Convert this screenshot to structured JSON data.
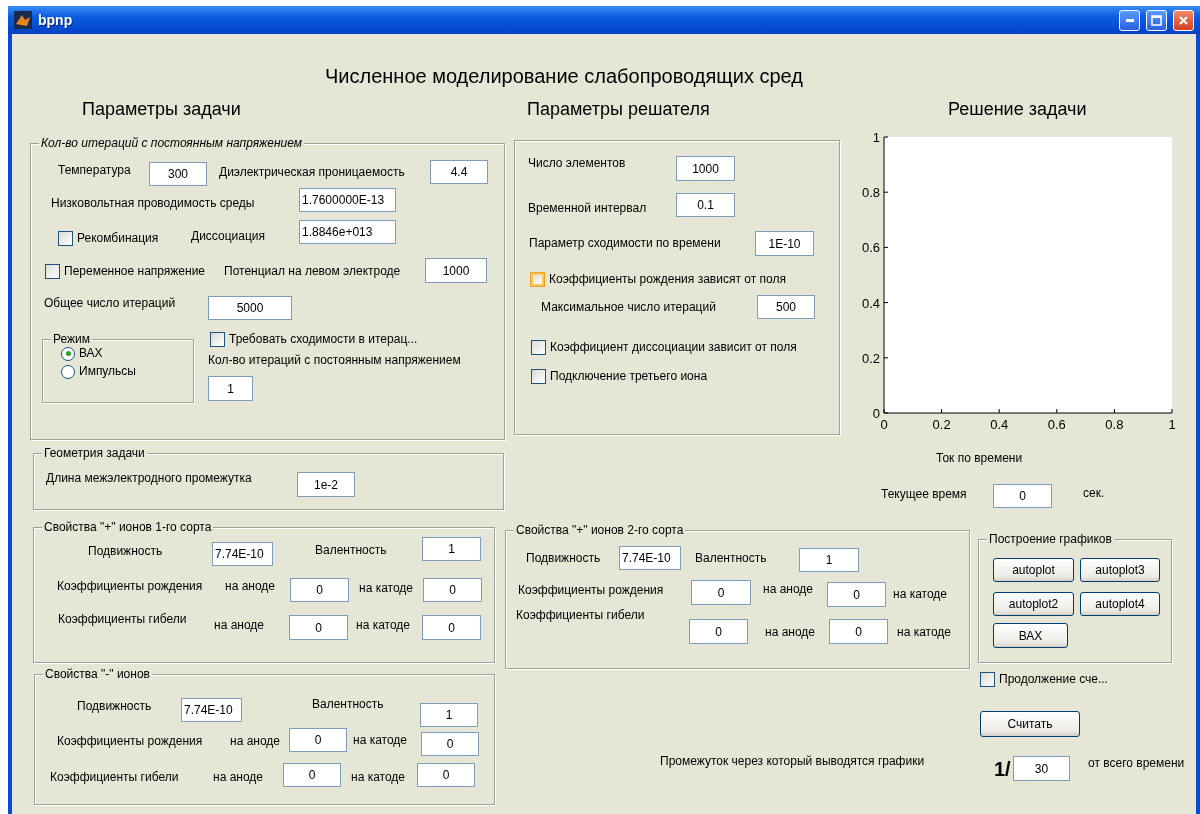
{
  "window": {
    "title": "bpnp"
  },
  "heading": "Численное моделирование слабопроводящих сред",
  "section_titles": [
    "Параметры задачи",
    "Параметры решателя",
    "Решение задачи"
  ],
  "panels": [
    {
      "title": "Кол-во итераций с постоянным напряжением",
      "controls": [
        {
          "kind": "label",
          "text": "Температура"
        },
        {
          "kind": "field",
          "value": "300"
        },
        {
          "kind": "label",
          "text": "Диэлектрическая проницаемость"
        },
        {
          "kind": "field",
          "value": "4.4"
        },
        {
          "kind": "label",
          "text": "Низковольтная проводимость среды"
        },
        {
          "kind": "field",
          "value": "1.7600000E-13"
        },
        {
          "kind": "checkbox",
          "text": "Рекомбинация",
          "checked": false
        },
        {
          "kind": "label",
          "text": "Диссоциация"
        },
        {
          "kind": "field",
          "value": "1.8846e+013"
        },
        {
          "kind": "checkbox",
          "text": "Переменное напряжение",
          "checked": false
        },
        {
          "kind": "label",
          "text": "Потенциал на левом электроде"
        },
        {
          "kind": "field",
          "value": "1000"
        },
        {
          "kind": "label",
          "text": "Общее число итераций"
        },
        {
          "kind": "field",
          "value": "5000"
        },
        {
          "kind": "checkbox",
          "text": "Требовать сходимости в итерац...",
          "checked": false
        },
        {
          "kind": "label",
          "text": "Кол-во итераций с постоянным напряжением"
        },
        {
          "kind": "field",
          "value": "1"
        }
      ]
    },
    {
      "title": "Режим",
      "controls": [
        {
          "kind": "radio",
          "text": "ВАХ",
          "selected": true
        },
        {
          "kind": "radio",
          "text": "Импульсы",
          "selected": false
        }
      ]
    },
    {
      "controls": [
        {
          "kind": "label",
          "text": "Число элементов"
        },
        {
          "kind": "field",
          "value": "1000"
        },
        {
          "kind": "label",
          "text": "Временной интервал"
        },
        {
          "kind": "field",
          "value": "0.1"
        },
        {
          "kind": "label",
          "text": "Параметр сходимости по времени"
        },
        {
          "kind": "field",
          "value": "1E-10"
        },
        {
          "kind": "checkbox",
          "text": "Коэффициенты рождения зависят от поля",
          "checked": false,
          "hovered": true
        },
        {
          "kind": "label",
          "text": "Максимальное число итераций"
        },
        {
          "kind": "field",
          "value": "500"
        },
        {
          "kind": "checkbox",
          "text": "Коэффициент диссоциации зависит от поля",
          "checked": false
        },
        {
          "kind": "checkbox",
          "text": "Подключение третьего иона",
          "checked": false
        }
      ]
    },
    {
      "title": "Геометрия задачи",
      "controls": [
        {
          "kind": "label",
          "text": "Длина межэлектродного промежутка"
        },
        {
          "kind": "field",
          "value": "1e-2"
        }
      ]
    },
    {
      "title": "Свойства \"+\" ионов 1-го сорта",
      "controls": [
        {
          "kind": "label",
          "text": "Подвижность"
        },
        {
          "kind": "field",
          "value": "7.74E-10"
        },
        {
          "kind": "label",
          "text": "Валентность"
        },
        {
          "kind": "field",
          "value": "1"
        },
        {
          "kind": "label",
          "text": "Коэффициенты рождения"
        },
        {
          "kind": "label",
          "text": "на аноде"
        },
        {
          "kind": "field",
          "value": "0"
        },
        {
          "kind": "label",
          "text": "на катоде"
        },
        {
          "kind": "field",
          "value": "0"
        },
        {
          "kind": "label",
          "text": "Коэффициенты гибели"
        },
        {
          "kind": "label",
          "text": "на аноде"
        },
        {
          "kind": "field",
          "value": "0"
        },
        {
          "kind": "label",
          "text": "на катоде"
        },
        {
          "kind": "field",
          "value": "0"
        }
      ]
    },
    {
      "title": "Свойства \"-\" ионов",
      "controls": [
        {
          "kind": "label",
          "text": "Подвижность"
        },
        {
          "kind": "field",
          "value": "7.74E-10"
        },
        {
          "kind": "label",
          "text": "Валентность"
        },
        {
          "kind": "field",
          "value": "1"
        },
        {
          "kind": "label",
          "text": "Коэффициенты рождения"
        },
        {
          "kind": "label",
          "text": "на аноде"
        },
        {
          "kind": "field",
          "value": "0"
        },
        {
          "kind": "label",
          "text": "на катоде"
        },
        {
          "kind": "field",
          "value": "0"
        },
        {
          "kind": "label",
          "text": "Коэффициенты гибели"
        },
        {
          "kind": "label",
          "text": "на аноде"
        },
        {
          "kind": "field",
          "value": "0"
        },
        {
          "kind": "label",
          "text": "на катоде"
        },
        {
          "kind": "field",
          "value": "0"
        }
      ]
    },
    {
      "title": "Свойства \"+\" ионов 2-го сорта",
      "controls": [
        {
          "kind": "label",
          "text": "Подвижность"
        },
        {
          "kind": "field",
          "value": "7.74E-10"
        },
        {
          "kind": "label",
          "text": "Валентность"
        },
        {
          "kind": "field",
          "value": "1"
        },
        {
          "kind": "label",
          "text": "Коэффициенты рождения"
        },
        {
          "kind": "field",
          "value": "0"
        },
        {
          "kind": "label",
          "text": "на аноде"
        },
        {
          "kind": "field",
          "value": "0"
        },
        {
          "kind": "label",
          "text": "на катоде"
        },
        {
          "kind": "label",
          "text": "Коэффициенты гибели"
        },
        {
          "kind": "field",
          "value": "0"
        },
        {
          "kind": "label",
          "text": "на аноде"
        },
        {
          "kind": "field",
          "value": "0"
        },
        {
          "kind": "label",
          "text": "на катоде"
        }
      ]
    },
    {
      "title": "Построение графиков",
      "controls": [
        {
          "kind": "button",
          "text": "autoplot"
        },
        {
          "kind": "button",
          "text": "autoplot3"
        },
        {
          "kind": "button",
          "text": "autoplot2"
        },
        {
          "kind": "button",
          "text": "autoplot4"
        },
        {
          "kind": "button",
          "text": "ВАХ"
        }
      ]
    }
  ],
  "plot": {
    "chart_data": {
      "type": "line",
      "xlim": [
        0,
        1
      ],
      "ylim": [
        0,
        1
      ],
      "xticks": [
        0,
        0.2,
        0.4,
        0.6,
        0.8,
        1
      ],
      "yticks": [
        0,
        0.2,
        0.4,
        0.6,
        0.8,
        1
      ]
    },
    "caption": "Ток по времени"
  },
  "controls": [
    {
      "kind": "label",
      "text": "Текущее время"
    },
    {
      "kind": "field",
      "value": "0"
    },
    {
      "kind": "label",
      "text": "сек."
    },
    {
      "kind": "checkbox",
      "text": "Продолжение сче...",
      "checked": false
    },
    {
      "kind": "button",
      "text": "Считать"
    },
    {
      "kind": "label",
      "text": "Промежуток через который выводятся графики"
    },
    {
      "kind": "big_label",
      "text": "1/"
    },
    {
      "kind": "field",
      "value": "30"
    },
    {
      "kind": "label",
      "text": "от всего времени"
    }
  ]
}
